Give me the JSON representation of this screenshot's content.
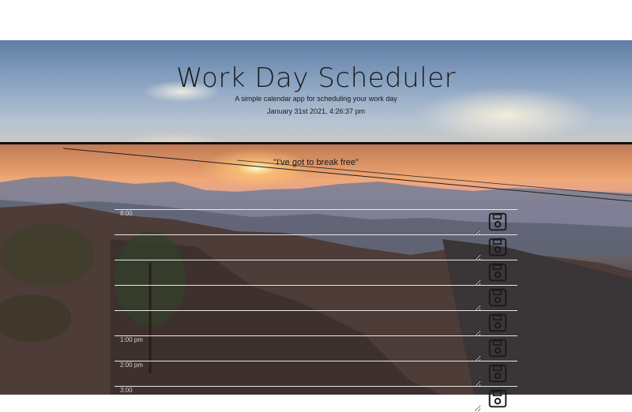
{
  "header": {
    "title": "Work Day Scheduler",
    "lead": "A simple calendar app for scheduling your work day",
    "current_day": "January 31st 2021, 4:26:37 pm"
  },
  "quote": "\"I've got to break free\"",
  "timeblocks": [
    {
      "hour": "8:00",
      "value": ""
    },
    {
      "hour": "",
      "value": ""
    },
    {
      "hour": "",
      "value": ""
    },
    {
      "hour": "",
      "value": ""
    },
    {
      "hour": "",
      "value": ""
    },
    {
      "hour": "1:00 pm",
      "value": ""
    },
    {
      "hour": "2:00 pm",
      "value": ""
    },
    {
      "hour": "3:00",
      "value": ""
    }
  ],
  "icons": {
    "save": "floppy-disk-icon"
  },
  "colors": {
    "border": "#111111",
    "line": "#e8e8e8"
  }
}
